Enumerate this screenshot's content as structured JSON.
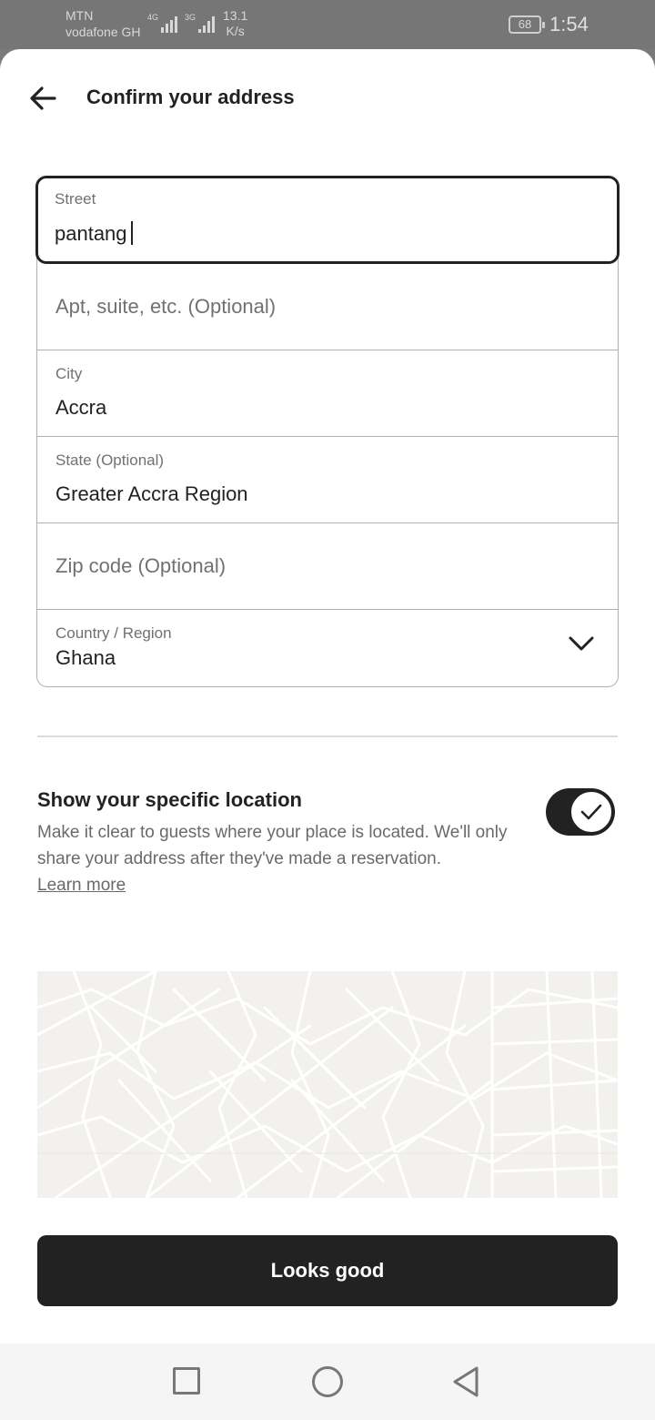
{
  "status": {
    "carrier1": "MTN",
    "carrier2": "vodafone GH",
    "net1": "4G",
    "net2": "3G",
    "speed_value": "13.1",
    "speed_unit": "K/s",
    "battery": "68",
    "time": "1:54"
  },
  "header": {
    "title": "Confirm your address"
  },
  "form": {
    "street": {
      "label": "Street",
      "value": "pantang"
    },
    "apt": {
      "placeholder": "Apt, suite, etc. (Optional)"
    },
    "city": {
      "label": "City",
      "value": "Accra"
    },
    "state": {
      "label": "State (Optional)",
      "value": "Greater Accra Region"
    },
    "zip": {
      "placeholder": "Zip code (Optional)"
    },
    "country": {
      "label": "Country / Region",
      "value": "Ghana"
    }
  },
  "location": {
    "title": "Show your specific location",
    "description": "Make it clear to guests where your place is located. We'll only share your address after they've made a reservation.",
    "learn_more": "Learn more",
    "toggle_on": true
  },
  "actions": {
    "primary": "Looks good"
  },
  "colors": {
    "text": "#222222",
    "muted": "#717171",
    "button_bg": "#222222",
    "map_bg": "#f3f1ee"
  }
}
